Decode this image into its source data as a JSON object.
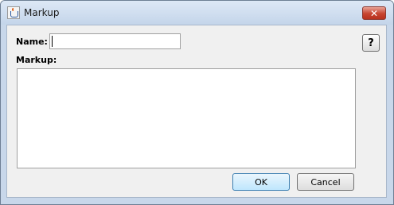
{
  "window": {
    "title": "Markup",
    "close_label": "✕"
  },
  "form": {
    "name_label": "Name:",
    "name_value": "",
    "markup_label": "Markup:",
    "markup_value": "",
    "help_label": "?"
  },
  "buttons": {
    "ok_label": "OK",
    "cancel_label": "Cancel"
  }
}
